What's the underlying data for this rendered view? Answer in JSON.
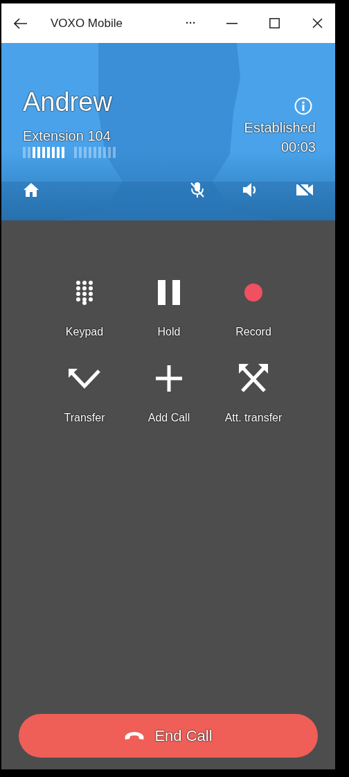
{
  "window": {
    "title": "VOXO Mobile",
    "menu": "···"
  },
  "call": {
    "name": "Andrew",
    "extension": "Extension 104",
    "status": "Established",
    "duration": "00:03",
    "meter": {
      "level": 0.75
    }
  },
  "actions": [
    {
      "kind": "keypad",
      "label": "Keypad"
    },
    {
      "kind": "hold",
      "label": "Hold"
    },
    {
      "kind": "record",
      "label": "Record"
    },
    {
      "kind": "transfer",
      "label": "Transfer"
    },
    {
      "kind": "add",
      "label": "Add Call"
    },
    {
      "kind": "att_transfer",
      "label": "Att. transfer"
    }
  ],
  "end_button": {
    "label": "End Call"
  }
}
